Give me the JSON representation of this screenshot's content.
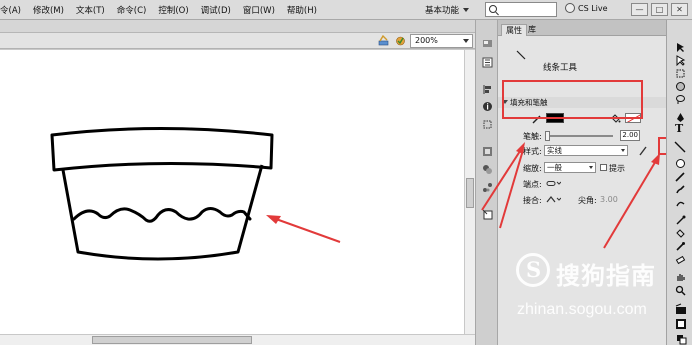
{
  "menu": {
    "items": [
      "令(A)",
      "修改(M)",
      "文本(T)",
      "命令(C)",
      "控制(O)",
      "调试(D)",
      "窗口(W)",
      "帮助(H)"
    ],
    "workspace": "基本功能",
    "cs_live": "CS Live"
  },
  "window_controls": [
    "—",
    "□",
    "✕"
  ],
  "stage": {
    "zoom": "200%"
  },
  "properties_panel": {
    "tabs": [
      "属性",
      "库"
    ],
    "tool_name": "线条工具",
    "section_fill_stroke": "填充和笔触",
    "stroke_label": "笔触:",
    "stroke_value": "2.00",
    "style_label": "样式:",
    "style_value": "实线",
    "scale_label": "缩放:",
    "scale_value": "一般",
    "hint_label": "提示",
    "cap_label": "端点:",
    "join_label": "接合:",
    "miter_label": "尖角:",
    "miter_value": "3.00",
    "stroke_color": "#000000",
    "fill_color": "none"
  },
  "watermark": {
    "title": "搜狗指南",
    "url": "zhinan.sogou.com"
  },
  "colors": {
    "annotation_red": "#e23a3a",
    "canvas": "#ffffff"
  }
}
